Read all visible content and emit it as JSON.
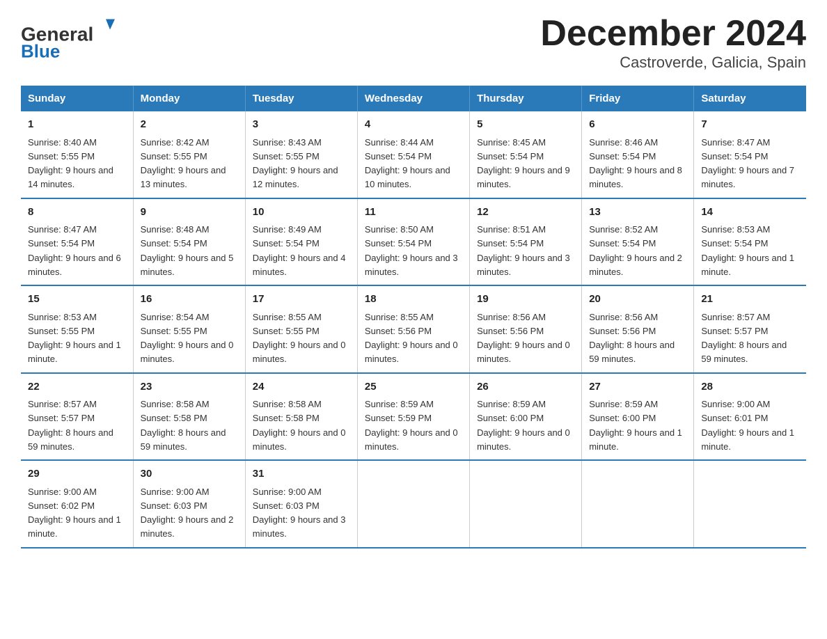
{
  "header": {
    "logo_general": "General",
    "logo_blue": "Blue",
    "title": "December 2024",
    "subtitle": "Castroverde, Galicia, Spain"
  },
  "days_of_week": [
    "Sunday",
    "Monday",
    "Tuesday",
    "Wednesday",
    "Thursday",
    "Friday",
    "Saturday"
  ],
  "weeks": [
    [
      {
        "day": "1",
        "sunrise": "Sunrise: 8:40 AM",
        "sunset": "Sunset: 5:55 PM",
        "daylight": "Daylight: 9 hours and 14 minutes."
      },
      {
        "day": "2",
        "sunrise": "Sunrise: 8:42 AM",
        "sunset": "Sunset: 5:55 PM",
        "daylight": "Daylight: 9 hours and 13 minutes."
      },
      {
        "day": "3",
        "sunrise": "Sunrise: 8:43 AM",
        "sunset": "Sunset: 5:55 PM",
        "daylight": "Daylight: 9 hours and 12 minutes."
      },
      {
        "day": "4",
        "sunrise": "Sunrise: 8:44 AM",
        "sunset": "Sunset: 5:54 PM",
        "daylight": "Daylight: 9 hours and 10 minutes."
      },
      {
        "day": "5",
        "sunrise": "Sunrise: 8:45 AM",
        "sunset": "Sunset: 5:54 PM",
        "daylight": "Daylight: 9 hours and 9 minutes."
      },
      {
        "day": "6",
        "sunrise": "Sunrise: 8:46 AM",
        "sunset": "Sunset: 5:54 PM",
        "daylight": "Daylight: 9 hours and 8 minutes."
      },
      {
        "day": "7",
        "sunrise": "Sunrise: 8:47 AM",
        "sunset": "Sunset: 5:54 PM",
        "daylight": "Daylight: 9 hours and 7 minutes."
      }
    ],
    [
      {
        "day": "8",
        "sunrise": "Sunrise: 8:47 AM",
        "sunset": "Sunset: 5:54 PM",
        "daylight": "Daylight: 9 hours and 6 minutes."
      },
      {
        "day": "9",
        "sunrise": "Sunrise: 8:48 AM",
        "sunset": "Sunset: 5:54 PM",
        "daylight": "Daylight: 9 hours and 5 minutes."
      },
      {
        "day": "10",
        "sunrise": "Sunrise: 8:49 AM",
        "sunset": "Sunset: 5:54 PM",
        "daylight": "Daylight: 9 hours and 4 minutes."
      },
      {
        "day": "11",
        "sunrise": "Sunrise: 8:50 AM",
        "sunset": "Sunset: 5:54 PM",
        "daylight": "Daylight: 9 hours and 3 minutes."
      },
      {
        "day": "12",
        "sunrise": "Sunrise: 8:51 AM",
        "sunset": "Sunset: 5:54 PM",
        "daylight": "Daylight: 9 hours and 3 minutes."
      },
      {
        "day": "13",
        "sunrise": "Sunrise: 8:52 AM",
        "sunset": "Sunset: 5:54 PM",
        "daylight": "Daylight: 9 hours and 2 minutes."
      },
      {
        "day": "14",
        "sunrise": "Sunrise: 8:53 AM",
        "sunset": "Sunset: 5:54 PM",
        "daylight": "Daylight: 9 hours and 1 minute."
      }
    ],
    [
      {
        "day": "15",
        "sunrise": "Sunrise: 8:53 AM",
        "sunset": "Sunset: 5:55 PM",
        "daylight": "Daylight: 9 hours and 1 minute."
      },
      {
        "day": "16",
        "sunrise": "Sunrise: 8:54 AM",
        "sunset": "Sunset: 5:55 PM",
        "daylight": "Daylight: 9 hours and 0 minutes."
      },
      {
        "day": "17",
        "sunrise": "Sunrise: 8:55 AM",
        "sunset": "Sunset: 5:55 PM",
        "daylight": "Daylight: 9 hours and 0 minutes."
      },
      {
        "day": "18",
        "sunrise": "Sunrise: 8:55 AM",
        "sunset": "Sunset: 5:56 PM",
        "daylight": "Daylight: 9 hours and 0 minutes."
      },
      {
        "day": "19",
        "sunrise": "Sunrise: 8:56 AM",
        "sunset": "Sunset: 5:56 PM",
        "daylight": "Daylight: 9 hours and 0 minutes."
      },
      {
        "day": "20",
        "sunrise": "Sunrise: 8:56 AM",
        "sunset": "Sunset: 5:56 PM",
        "daylight": "Daylight: 8 hours and 59 minutes."
      },
      {
        "day": "21",
        "sunrise": "Sunrise: 8:57 AM",
        "sunset": "Sunset: 5:57 PM",
        "daylight": "Daylight: 8 hours and 59 minutes."
      }
    ],
    [
      {
        "day": "22",
        "sunrise": "Sunrise: 8:57 AM",
        "sunset": "Sunset: 5:57 PM",
        "daylight": "Daylight: 8 hours and 59 minutes."
      },
      {
        "day": "23",
        "sunrise": "Sunrise: 8:58 AM",
        "sunset": "Sunset: 5:58 PM",
        "daylight": "Daylight: 8 hours and 59 minutes."
      },
      {
        "day": "24",
        "sunrise": "Sunrise: 8:58 AM",
        "sunset": "Sunset: 5:58 PM",
        "daylight": "Daylight: 9 hours and 0 minutes."
      },
      {
        "day": "25",
        "sunrise": "Sunrise: 8:59 AM",
        "sunset": "Sunset: 5:59 PM",
        "daylight": "Daylight: 9 hours and 0 minutes."
      },
      {
        "day": "26",
        "sunrise": "Sunrise: 8:59 AM",
        "sunset": "Sunset: 6:00 PM",
        "daylight": "Daylight: 9 hours and 0 minutes."
      },
      {
        "day": "27",
        "sunrise": "Sunrise: 8:59 AM",
        "sunset": "Sunset: 6:00 PM",
        "daylight": "Daylight: 9 hours and 1 minute."
      },
      {
        "day": "28",
        "sunrise": "Sunrise: 9:00 AM",
        "sunset": "Sunset: 6:01 PM",
        "daylight": "Daylight: 9 hours and 1 minute."
      }
    ],
    [
      {
        "day": "29",
        "sunrise": "Sunrise: 9:00 AM",
        "sunset": "Sunset: 6:02 PM",
        "daylight": "Daylight: 9 hours and 1 minute."
      },
      {
        "day": "30",
        "sunrise": "Sunrise: 9:00 AM",
        "sunset": "Sunset: 6:03 PM",
        "daylight": "Daylight: 9 hours and 2 minutes."
      },
      {
        "day": "31",
        "sunrise": "Sunrise: 9:00 AM",
        "sunset": "Sunset: 6:03 PM",
        "daylight": "Daylight: 9 hours and 3 minutes."
      },
      null,
      null,
      null,
      null
    ]
  ]
}
